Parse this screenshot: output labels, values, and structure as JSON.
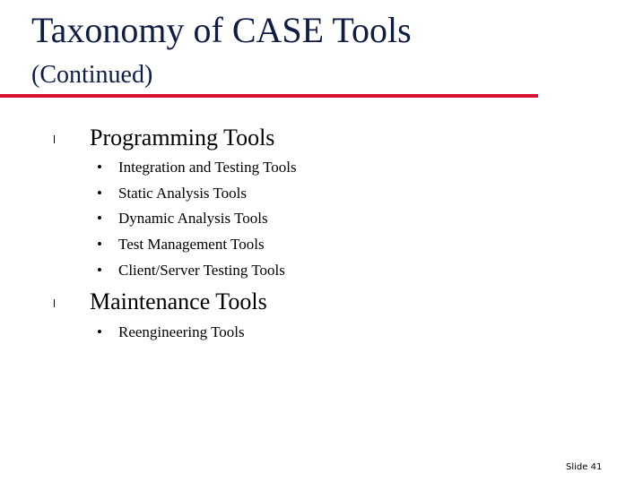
{
  "slide": {
    "title": "Taxonomy of CASE Tools",
    "subtitle": "(Continued)",
    "accent_color": "#d9102e",
    "title_color": "#0f1d45",
    "sections": [
      {
        "heading": "Programming Tools",
        "items": [
          "Integration and Testing Tools",
          "Static Analysis Tools",
          "Dynamic Analysis Tools",
          "Test Management Tools",
          "Client/Server Testing Tools"
        ]
      },
      {
        "heading": "Maintenance Tools",
        "items": [
          "Reengineering Tools"
        ]
      }
    ],
    "bullet_glyph": "•",
    "footer": "Slide 41"
  }
}
